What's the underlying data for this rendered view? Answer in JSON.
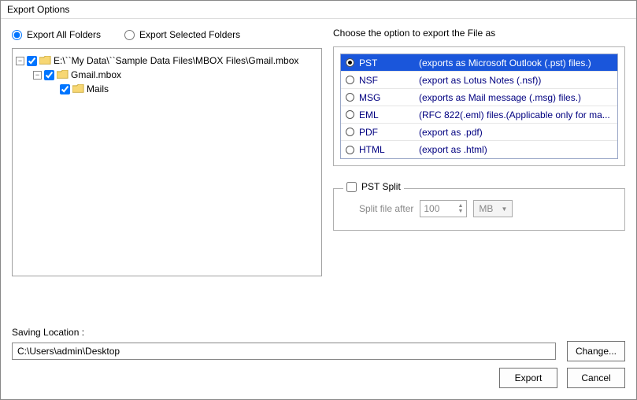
{
  "window": {
    "title": "Export Options"
  },
  "scope": {
    "all": "Export All Folders",
    "selected": "Export Selected Folders",
    "value": "all"
  },
  "tree": {
    "root": {
      "expanded": true,
      "checked": true,
      "label": "E:\\``My Data\\``Sample Data Files\\MBOX Files\\Gmail.mbox"
    },
    "child": {
      "expanded": true,
      "checked": true,
      "label": "Gmail.mbox"
    },
    "leaf": {
      "checked": true,
      "label": "Mails"
    }
  },
  "choose_label": "Choose the option to export the File as",
  "formats": [
    {
      "name": "PST",
      "desc": "(exports as Microsoft Outlook (.pst) files.)",
      "selected": true
    },
    {
      "name": "NSF",
      "desc": "(export as Lotus Notes (.nsf))",
      "selected": false
    },
    {
      "name": "MSG",
      "desc": "(exports as Mail message (.msg) files.)",
      "selected": false
    },
    {
      "name": "EML",
      "desc": "(RFC 822(.eml) files.(Applicable only for ma...",
      "selected": false
    },
    {
      "name": "PDF",
      "desc": "(export as .pdf)",
      "selected": false
    },
    {
      "name": "HTML",
      "desc": "(export as .html)",
      "selected": false
    }
  ],
  "split": {
    "title": "PST Split",
    "checked": false,
    "after_label": "Split file after",
    "value": "100",
    "unit": "MB"
  },
  "saving": {
    "label": "Saving Location :",
    "path": "C:\\Users\\admin\\Desktop",
    "change": "Change..."
  },
  "buttons": {
    "export": "Export",
    "cancel": "Cancel"
  }
}
